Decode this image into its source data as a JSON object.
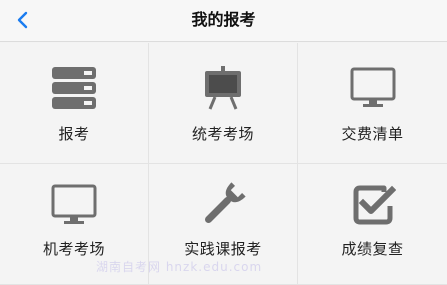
{
  "header": {
    "title": "我的报考",
    "back_icon": "chevron-left-icon"
  },
  "colors": {
    "accent": "#1a7cf0",
    "icon_gray": "#6e6e6e",
    "text": "#222222"
  },
  "menu": [
    {
      "label": "报考",
      "icon": "database-stack-icon"
    },
    {
      "label": "统考考场",
      "icon": "easel-board-icon"
    },
    {
      "label": "交费清单",
      "icon": "monitor-icon"
    },
    {
      "label": "机考考场",
      "icon": "monitor-icon"
    },
    {
      "label": "实践课报考",
      "icon": "wrench-icon"
    },
    {
      "label": "成绩复查",
      "icon": "checkbox-icon"
    }
  ],
  "watermark": "湖南自考网 hnzk.edu.com"
}
